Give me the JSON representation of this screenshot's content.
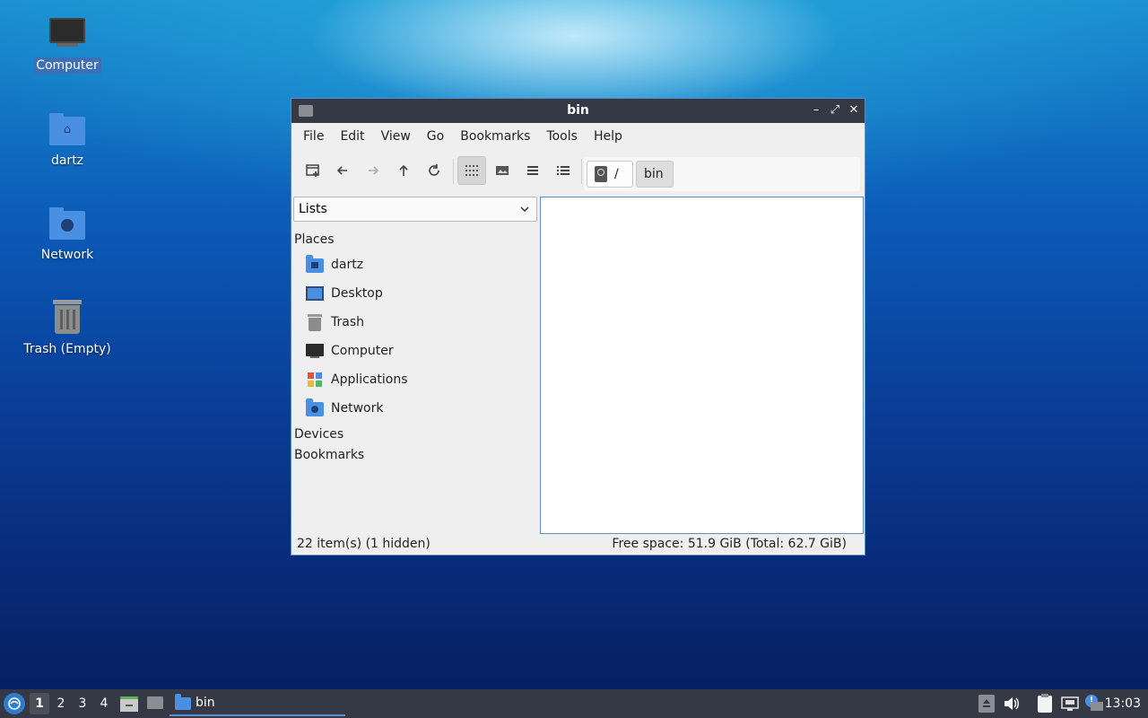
{
  "desktop": {
    "icons": [
      {
        "label": "Computer",
        "icon": "computer-icon"
      },
      {
        "label": "dartz",
        "icon": "home-folder-icon"
      },
      {
        "label": "Network",
        "icon": "network-folder-icon"
      },
      {
        "label": "Trash (Empty)",
        "icon": "trash-icon"
      }
    ]
  },
  "window": {
    "title": "bin",
    "menu": [
      "File",
      "Edit",
      "View",
      "Go",
      "Bookmarks",
      "Tools",
      "Help"
    ],
    "path": {
      "root": "/",
      "current": "bin"
    },
    "sidebar": {
      "dropdown_value": "Lists",
      "places_header": "Places",
      "places": [
        {
          "label": "dartz",
          "icon": "home-folder-icon"
        },
        {
          "label": "Desktop",
          "icon": "desktop-icon"
        },
        {
          "label": "Trash",
          "icon": "trash-icon"
        },
        {
          "label": "Computer",
          "icon": "computer-icon"
        },
        {
          "label": "Applications",
          "icon": "applications-icon"
        },
        {
          "label": "Network",
          "icon": "network-folder-icon"
        }
      ],
      "devices_header": "Devices",
      "bookmarks_header": "Bookmarks"
    },
    "status": {
      "items": "22 item(s) (1 hidden)",
      "free_space": "Free space: 51.9 GiB (Total: 62.7 GiB)"
    }
  },
  "taskbar": {
    "workspaces": [
      "1",
      "2",
      "3",
      "4"
    ],
    "active_workspace": "1",
    "task_label": "bin",
    "clock": "13:03"
  },
  "colors": {
    "titlebar": "#353945",
    "accent": "#4a90e2",
    "selection": "#3d6fb6"
  }
}
